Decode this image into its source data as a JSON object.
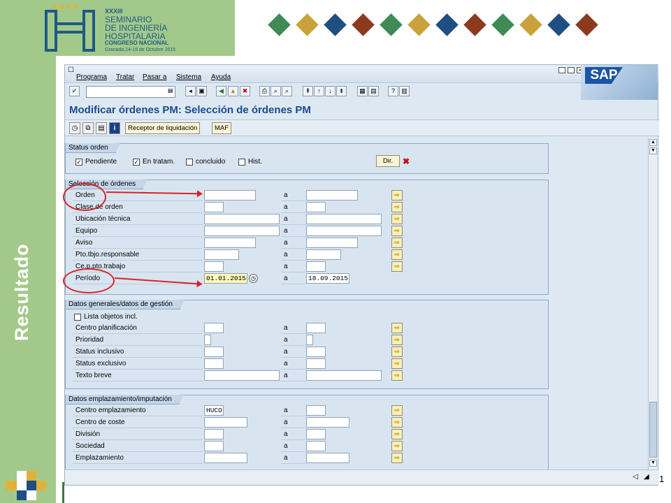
{
  "header": {
    "logo_lines": [
      "XXXIII",
      "SEMINARIO",
      "DE INGENIERÍA",
      "HOSPITALARIA",
      "CONGRESO NACIONAL",
      "Granada,14-16 de Octubre 2015"
    ],
    "diamond_colors": [
      "#3f8a55",
      "#c9a23b",
      "#1f4e82",
      "#8b3a1e",
      "#3f8a55",
      "#c9a23b",
      "#1f4e82",
      "#8b3a1e",
      "#3f8a55",
      "#c9a23b",
      "#1f4e82",
      "#8b3a1e"
    ]
  },
  "side_title": "Resultado",
  "page_number": "1",
  "sap": {
    "menu": [
      "Programa",
      "Tratar",
      "Pasar a",
      "Sistema",
      "Ayuda"
    ],
    "brand": "SAP",
    "title": "Modificar órdenes PM: Selección de órdenes PM",
    "app_buttons": [
      "Receptor de liquidación",
      "MAF"
    ],
    "status_group": {
      "title": "Status orden",
      "checkboxes": [
        {
          "label": "Pendiente",
          "checked": true
        },
        {
          "label": "En tratam.",
          "checked": true
        },
        {
          "label": "concluido",
          "checked": false
        },
        {
          "label": "Hist.",
          "checked": false
        }
      ],
      "dir_button": "Dir."
    },
    "selection_group": {
      "title": "Selección de órdenes",
      "rows": [
        {
          "label": "Orden",
          "from": "",
          "to": "",
          "sep": "a"
        },
        {
          "label": "Clase de orden",
          "from": "",
          "to": "",
          "sep": "a"
        },
        {
          "label": "Ubicación técnica",
          "from": "",
          "to": "",
          "sep": "a"
        },
        {
          "label": "Equipo",
          "from": "",
          "to": "",
          "sep": "a"
        },
        {
          "label": "Aviso",
          "from": "",
          "to": "",
          "sep": "a"
        },
        {
          "label": "Pto.tbjo.responsable",
          "from": "",
          "to": "",
          "sep": "a"
        },
        {
          "label": "Ce.p.pto.trabajo",
          "from": "",
          "to": "",
          "sep": "a"
        },
        {
          "label": "Período",
          "from": "01.01.2015",
          "to": "18.09.2015",
          "sep": "a"
        }
      ]
    },
    "general_group": {
      "title": "Datos generales/datos de gestión",
      "checkbox": {
        "label": "Lista objetos incl.",
        "checked": false
      },
      "rows": [
        {
          "label": "Centro planificación",
          "from": "",
          "to": "",
          "sep": "a"
        },
        {
          "label": "Prioridad",
          "from": "",
          "to": "",
          "sep": "a"
        },
        {
          "label": "Status inclusivo",
          "from": "",
          "to": "",
          "sep": "a"
        },
        {
          "label": "Status exclusivo",
          "from": "",
          "to": "",
          "sep": "a"
        },
        {
          "label": "Texto breve",
          "from": "",
          "to": "",
          "sep": "a"
        }
      ]
    },
    "location_group": {
      "title": "Datos emplazamiento/imputación",
      "rows": [
        {
          "label": "Centro emplazamiento",
          "from": "HUCO",
          "to": "",
          "sep": "a"
        },
        {
          "label": "Centro de coste",
          "from": "",
          "to": "",
          "sep": "a"
        },
        {
          "label": "División",
          "from": "",
          "to": "",
          "sep": "a"
        },
        {
          "label": "Sociedad",
          "from": "",
          "to": "",
          "sep": "a"
        },
        {
          "label": "Emplazamiento",
          "from": "",
          "to": "",
          "sep": "a"
        }
      ]
    }
  }
}
